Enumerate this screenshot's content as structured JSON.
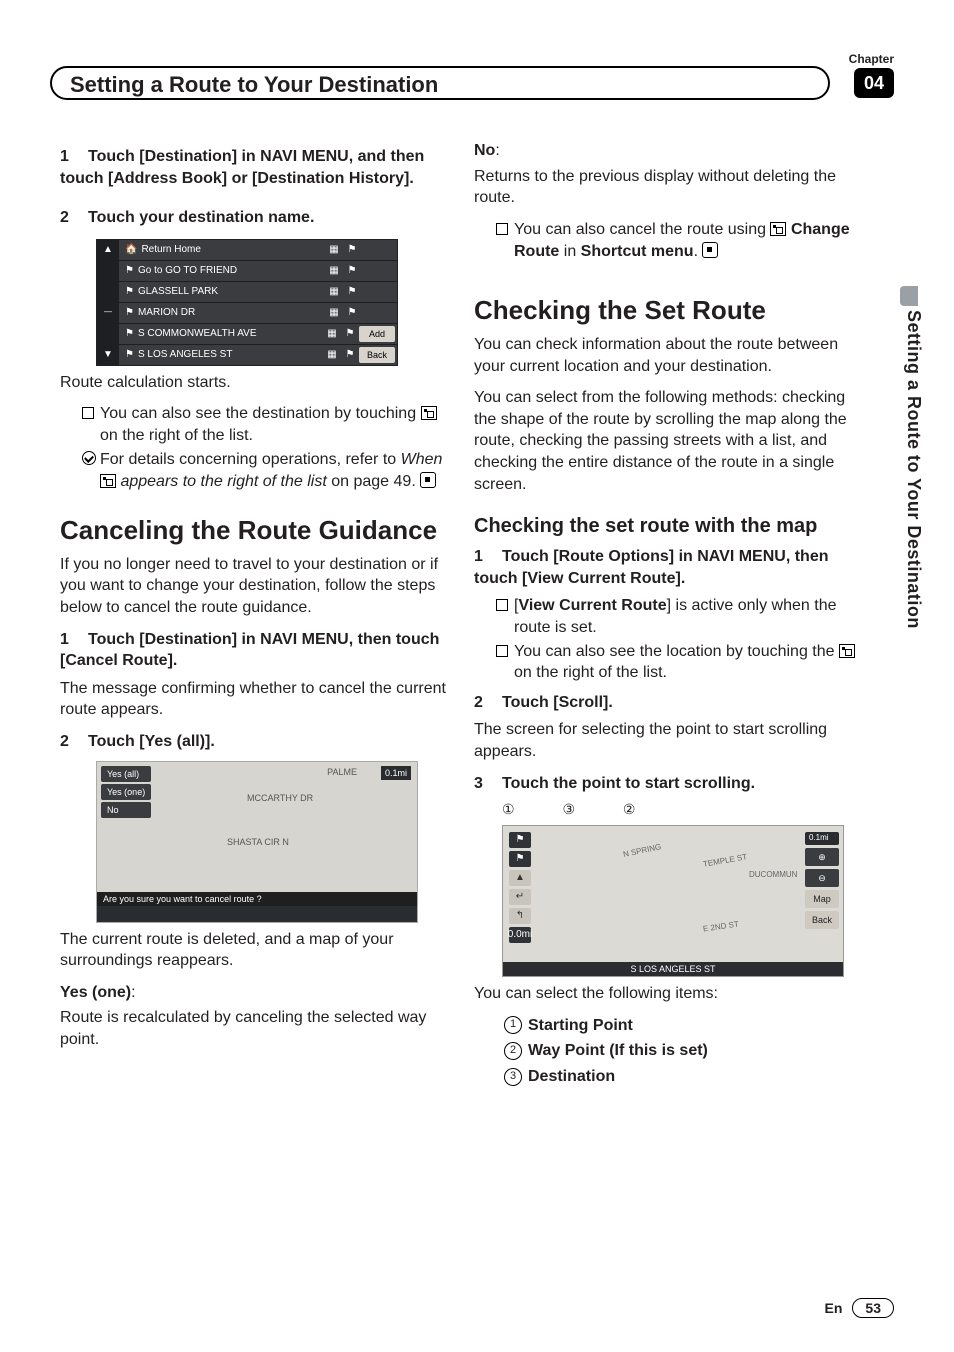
{
  "header": {
    "chapter_label": "Chapter",
    "chapter_number": "04",
    "title": "Setting a Route to Your Destination",
    "side_text": "Setting a Route to Your Destination"
  },
  "left": {
    "step1": "Touch [Destination] in NAVI MENU, and then touch [Address Book] or [Destination History].",
    "step2": "Touch your destination name.",
    "addr_rows": [
      {
        "label": "Return Home",
        "btn": ""
      },
      {
        "label": "Go to GO TO FRIEND",
        "btn": ""
      },
      {
        "label": "GLASSELL PARK",
        "btn": ""
      },
      {
        "label": "MARION DR",
        "btn": ""
      },
      {
        "label": "S COMMONWEALTH AVE",
        "btn": "Add"
      },
      {
        "label": "S LOS ANGELES ST",
        "btn": "Back"
      }
    ],
    "after_list": "Route calculation starts.",
    "bullet1a": "You can also see the destination by touch­ing ",
    "bullet1b": " on the right of the list.",
    "bullet2a": "For details concerning operations, refer to ",
    "bullet2b_italic": "When ",
    "bullet2c_italic": " appears to the right of the list",
    "bullet2d": " on page 49.",
    "h1_cancel": "Canceling the Route Guidance",
    "cancel_intro": "If you no longer need to travel to your destina­tion or if you want to change your destination, follow the steps below to cancel the route gui­dance.",
    "cancel_step1": "Touch [Destination] in NAVI MENU, then touch [Cancel Route].",
    "cancel_step1_body": "The message confirming whether to cancel the current route appears.",
    "cancel_step2": "Touch [Yes (all)].",
    "map_opts": [
      "Yes (all)",
      "Yes (one)",
      "No"
    ],
    "map_roads": {
      "a": "PALME",
      "b": "MCCARTHY DR",
      "c": "SHASTA CIR N"
    },
    "map_prompt": "Are you sure you want to cancel route ?",
    "cancel_after": "The current route is deleted, and a map of your surroundings reappears.",
    "yes_one_label": "Yes (one)",
    "yes_one_body": "Route is recalculated by canceling the se­lected way point."
  },
  "right": {
    "no_label": "No",
    "no_body": "Returns to the previous display without delet­ing the route.",
    "no_bullet_a": "You can also cancel the route using ",
    "no_bullet_b": "Change Route",
    "no_bullet_c": " in ",
    "no_bullet_d": "Shortcut menu",
    "h1_check": "Checking the Set Route",
    "check_intro1": "You can check information about the route be­tween your current location and your destina­tion.",
    "check_intro2": "You can select from the following methods: checking the shape of the route by scrolling the map along the route, checking the passing streets with a list, and checking the entire dis­tance of the route in a single screen.",
    "h2_map": "Checking the set route with the map",
    "map_step1": "Touch [Route Options] in NAVI MENU, then touch [View Current Route].",
    "map_b1a": "[",
    "map_b1b": "View Current Route",
    "map_b1c": "] is active only when the route is set.",
    "map_b2a": "You can also see the location by touching the ",
    "map_b2b": " on the right of the list.",
    "map_step2": "Touch [Scroll].",
    "map_step2_body": "The screen for selecting the point to start scrolling appears.",
    "map_step3": "Touch the point to start scrolling.",
    "markers": "① ③ ②",
    "map2_right": [
      "⊕",
      "⊖",
      "Map",
      "Back"
    ],
    "map2_street": "S LOS ANGELES ST",
    "map2_roads": {
      "a": "N SPRING",
      "b": "TEMPLE ST",
      "c": "DUCOMMUN",
      "d": "E 2ND ST",
      "e": "0.0mi",
      "f": "0.1mi"
    },
    "after_map2": "You can select the following items:",
    "item1": "Starting Point",
    "item2": "Way Point (If this is set)",
    "item3": "Destination"
  },
  "footer": {
    "lang": "En",
    "page": "53"
  }
}
